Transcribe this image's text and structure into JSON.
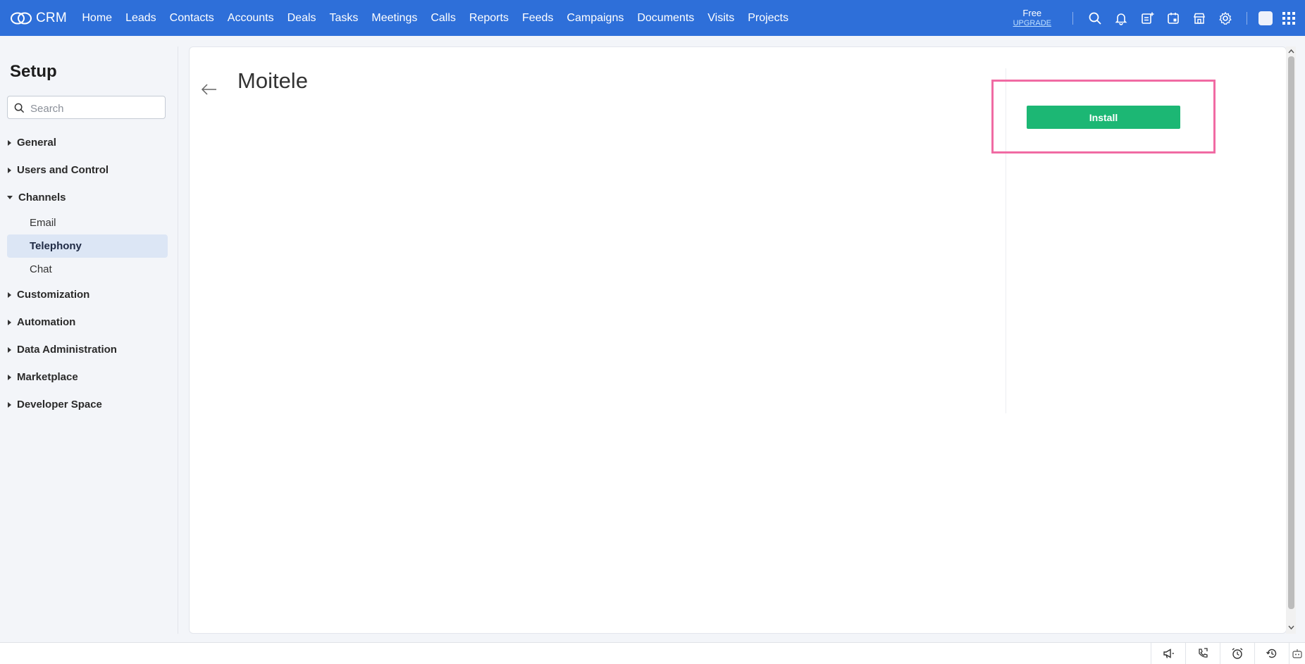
{
  "brand": {
    "name": "CRM"
  },
  "nav": [
    "Home",
    "Leads",
    "Contacts",
    "Accounts",
    "Deals",
    "Tasks",
    "Meetings",
    "Calls",
    "Reports",
    "Feeds",
    "Campaigns",
    "Documents",
    "Visits",
    "Projects"
  ],
  "plan": {
    "label": "Free",
    "upgrade": "UPGRADE"
  },
  "sidebar": {
    "title": "Setup",
    "search_placeholder": "Search",
    "items": [
      {
        "label": "General"
      },
      {
        "label": "Users and Control"
      },
      {
        "label": "Channels",
        "expanded": true,
        "children": [
          "Email",
          "Telephony",
          "Chat"
        ],
        "active_child": "Telephony"
      },
      {
        "label": "Customization"
      },
      {
        "label": "Automation"
      },
      {
        "label": "Data Administration"
      },
      {
        "label": "Marketplace"
      },
      {
        "label": "Developer Space"
      }
    ]
  },
  "main": {
    "title": "Moitele",
    "install_label": "Install"
  },
  "colors": {
    "topbar": "#2e6fd9",
    "install": "#1cb774",
    "highlight": "#f06ba3",
    "active_item": "#dce6f5"
  }
}
